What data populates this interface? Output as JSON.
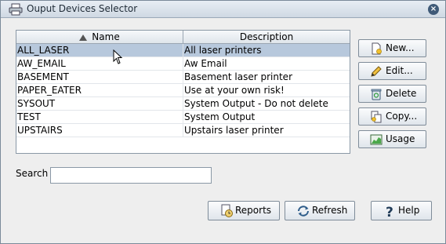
{
  "window": {
    "title": "Ouput Devices Selector"
  },
  "table": {
    "columns": {
      "name": "Name",
      "description": "Description"
    },
    "rows": [
      {
        "name": "ALL_LASER",
        "description": "All laser printers"
      },
      {
        "name": "AW_EMAIL",
        "description": "Aw Email"
      },
      {
        "name": "BASEMENT",
        "description": "Basement laser printer"
      },
      {
        "name": "PAPER_EATER",
        "description": "Use at your own risk!"
      },
      {
        "name": "SYSOUT",
        "description": "System Output - Do not delete"
      },
      {
        "name": "TEST",
        "description": "System Output"
      },
      {
        "name": "UPSTAIRS",
        "description": "Upstairs laser printer"
      }
    ],
    "selected_row": "ALL_LASER"
  },
  "buttons": {
    "new": "New...",
    "edit": "Edit...",
    "delete": "Delete",
    "copy": "Copy...",
    "usage": "Usage",
    "reports": "Reports",
    "refresh": "Refresh",
    "help": "Help"
  },
  "search": {
    "label": "Search",
    "value": ""
  },
  "icons": {
    "title": "printer-icon",
    "close": "close-icon",
    "new": "new-document-icon",
    "edit": "pencil-icon",
    "delete": "trash-icon",
    "copy": "copy-icon",
    "usage": "chart-icon",
    "reports": "report-icon",
    "refresh": "refresh-icon",
    "help": "help-icon"
  },
  "colors": {
    "selection": "#b7c8dc",
    "titlebar": "#cfd9e3"
  }
}
